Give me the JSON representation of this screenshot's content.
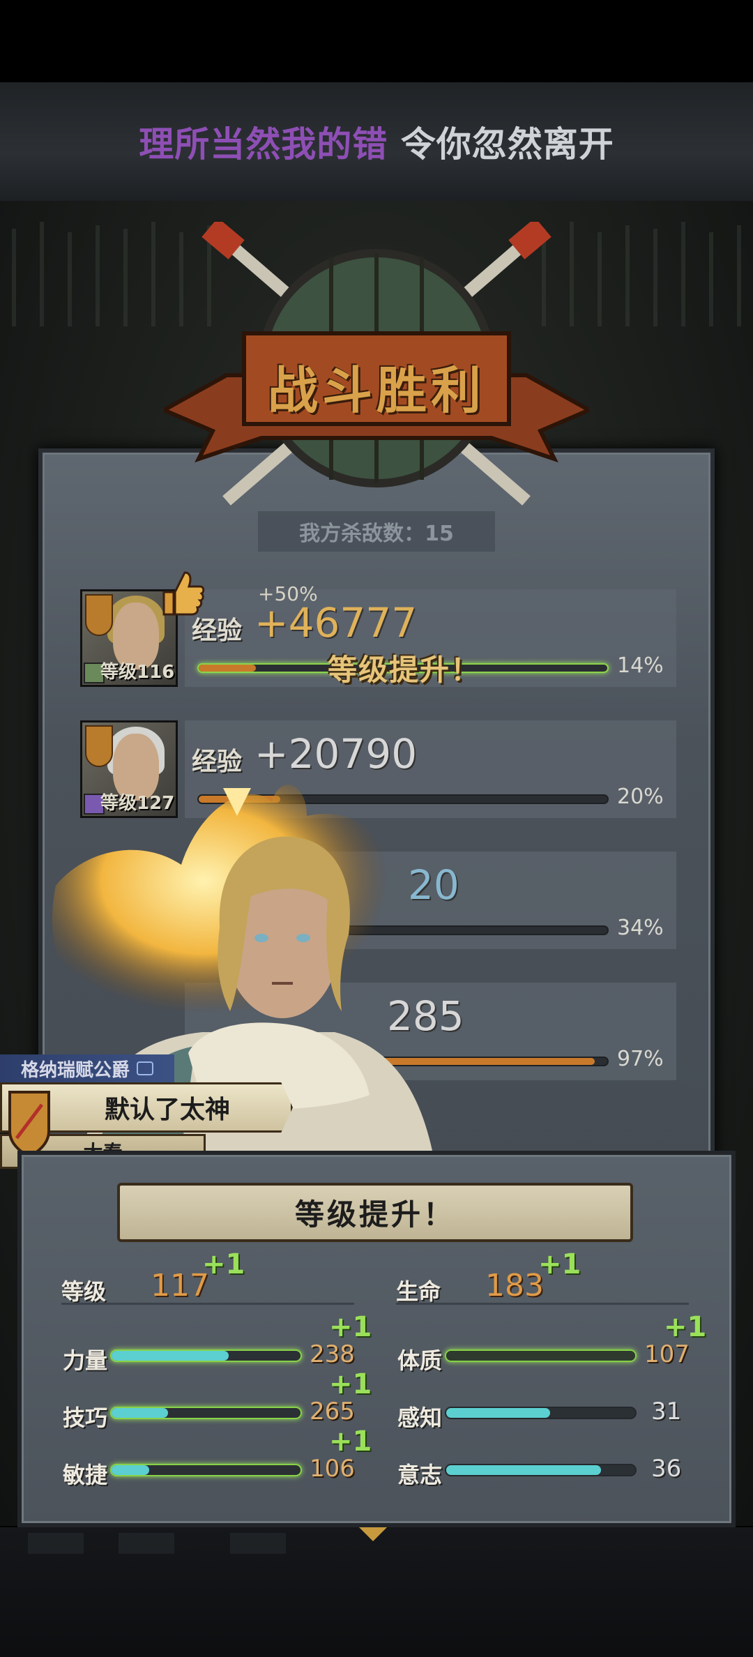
{
  "lyrics": {
    "sung": "理所当然我的错",
    "unsung": " 令你忽然离开"
  },
  "battle": {
    "title": "战斗胜利",
    "kills_label": "我方杀敌数：15"
  },
  "heroes": [
    {
      "exp_label": "经验",
      "exp_gain": "+46777",
      "bonus": "+50%",
      "level_label": "等级116",
      "progress_pct": "14%",
      "progress": 0.14,
      "level_up_text": "等级提升！",
      "hair": "blonde"
    },
    {
      "exp_label": "经验",
      "exp_gain": "+20790",
      "level_label": "等级127",
      "progress_pct": "20%",
      "progress": 0.2,
      "hair": "white"
    },
    {
      "exp_value_partial": "20",
      "progress_pct": "34%",
      "progress": 0.34
    },
    {
      "exp_value_partial": "285",
      "progress_pct": "97%",
      "progress": 0.97
    }
  ],
  "dialog": {
    "speaker": "格纳瑞赋公爵",
    "line": "默认了太神",
    "faction": "大秦"
  },
  "level_up": {
    "title": "等级提升！",
    "level": {
      "label": "等级",
      "value": "117",
      "plus": "+1"
    },
    "hp": {
      "label": "生命",
      "value": "183",
      "plus": "+1"
    },
    "stats": [
      {
        "label": "力量",
        "value": "238",
        "plus": "+1",
        "fill": 0.62,
        "highlight": true
      },
      {
        "label": "体质",
        "value": "107",
        "plus": "+1",
        "fill": 1.0,
        "highlight": true
      },
      {
        "label": "技巧",
        "value": "265",
        "plus": "+1",
        "fill": 0.3,
        "highlight": true
      },
      {
        "label": "感知",
        "value": "31",
        "plus": "",
        "fill": 0.55,
        "highlight": false
      },
      {
        "label": "敏捷",
        "value": "106",
        "plus": "+1",
        "fill": 0.2,
        "highlight": true
      },
      {
        "label": "意志",
        "value": "36",
        "plus": "",
        "fill": 0.82,
        "highlight": false
      }
    ]
  },
  "colors": {
    "accent_gold": "#e0b25a",
    "lyric_sung": "#8e4fb5",
    "plus_green": "#9be05a",
    "bar_cyan": "#5ccfd0"
  }
}
